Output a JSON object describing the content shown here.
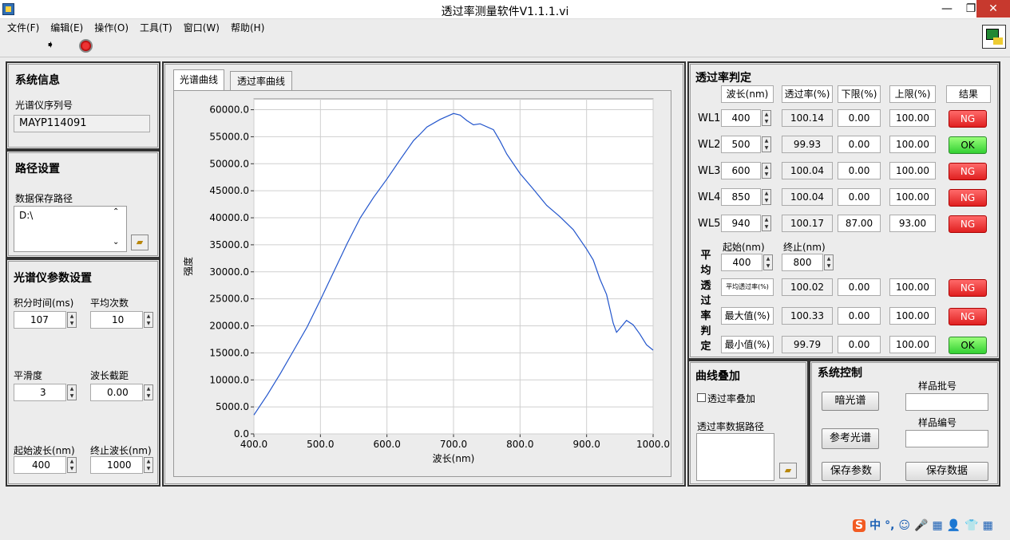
{
  "window": {
    "title": "透过率测量软件V1.1.1.vi",
    "min_glyph": "—",
    "max_glyph": "❐",
    "close_glyph": "✕"
  },
  "menu": [
    "文件(F)",
    "编辑(E)",
    "操作(O)",
    "工具(T)",
    "窗口(W)",
    "帮助(H)"
  ],
  "system_info": {
    "title": "系统信息",
    "serial_label": "光谱仪序列号",
    "serial_value": "MAYP114091"
  },
  "path_settings": {
    "title": "路径设置",
    "path_label": "数据保存路径",
    "path_value": "D:\\"
  },
  "spectrometer": {
    "title": "光谱仪参数设置",
    "integration_label": "积分时间(ms)",
    "integration_value": "107",
    "avg_label": "平均次数",
    "avg_value": "10",
    "smooth_label": "平滑度",
    "smooth_value": "3",
    "cutoff_label": "波长截距",
    "cutoff_value": "0.00",
    "start_label": "起始波长(nm)",
    "start_value": "400",
    "end_label": "终止波长(nm)",
    "end_value": "1000"
  },
  "tabs": [
    "光谱曲线",
    "透过率曲线"
  ],
  "chart_data": {
    "type": "line",
    "xlabel": "波长(nm)",
    "ylabel": "强度",
    "xlim": [
      400,
      1000
    ],
    "ylim": [
      0,
      62000
    ],
    "x_ticks": [
      "400.0",
      "500.0",
      "600.0",
      "700.0",
      "800.0",
      "900.0",
      "1000.0"
    ],
    "y_ticks": [
      "0.0",
      "5000.0",
      "10000.0",
      "15000.0",
      "20000.0",
      "25000.0",
      "30000.0",
      "35000.0",
      "40000.0",
      "45000.0",
      "50000.0",
      "55000.0",
      "60000.0"
    ],
    "grid": true,
    "series": [
      {
        "color": "#2255cc",
        "x": [
          400,
          420,
          440,
          460,
          480,
          500,
          520,
          540,
          560,
          580,
          600,
          620,
          640,
          650,
          660,
          680,
          700,
          710,
          720,
          730,
          740,
          760,
          770,
          780,
          800,
          820,
          840,
          860,
          880,
          900,
          910,
          920,
          930,
          940,
          945,
          950,
          960,
          970,
          980,
          990,
          1000
        ],
        "y": [
          3500,
          7200,
          11200,
          15500,
          19800,
          24800,
          30000,
          35200,
          40000,
          43800,
          47200,
          50800,
          54300,
          55500,
          56800,
          58200,
          59300,
          59000,
          58000,
          57200,
          57400,
          56300,
          54200,
          51800,
          48200,
          45300,
          42300,
          40200,
          37800,
          34200,
          32200,
          28700,
          25800,
          20500,
          18800,
          19500,
          21000,
          20200,
          18500,
          16500,
          15500
        ]
      }
    ]
  },
  "judgement": {
    "title": "透过率判定",
    "headers": [
      "波长(nm)",
      "透过率(%)",
      "下限(%)",
      "上限(%)",
      "结果"
    ],
    "rows": [
      {
        "label": "WL1",
        "wl": "400",
        "trans": "100.14",
        "low": "0.00",
        "high": "100.00",
        "result": "NG"
      },
      {
        "label": "WL2",
        "wl": "500",
        "trans": "99.93",
        "low": "0.00",
        "high": "100.00",
        "result": "OK"
      },
      {
        "label": "WL3",
        "wl": "600",
        "trans": "100.04",
        "low": "0.00",
        "high": "100.00",
        "result": "NG"
      },
      {
        "label": "WL4",
        "wl": "850",
        "trans": "100.04",
        "low": "0.00",
        "high": "100.00",
        "result": "NG"
      },
      {
        "label": "WL5",
        "wl": "940",
        "trans": "100.17",
        "low": "87.00",
        "high": "93.00",
        "result": "NG"
      }
    ],
    "avg_vertical": [
      "平",
      "均",
      "透",
      "过",
      "率",
      "判",
      "定"
    ],
    "start_label": "起始(nm)",
    "start_value": "400",
    "end_label": "终止(nm)",
    "end_value": "800",
    "stats": [
      {
        "label": "平均透过率(%)",
        "value": "100.02",
        "low": "0.00",
        "high": "100.00",
        "result": "NG"
      },
      {
        "label": "最大值(%)",
        "value": "100.33",
        "low": "0.00",
        "high": "100.00",
        "result": "NG"
      },
      {
        "label": "最小值(%)",
        "value": "99.79",
        "low": "0.00",
        "high": "100.00",
        "result": "OK"
      }
    ]
  },
  "overlay": {
    "title": "曲线叠加",
    "checkbox_label": "透过率叠加",
    "path_label": "透过率数据路径"
  },
  "control": {
    "title": "系统控制",
    "dark_btn": "暗光谱",
    "ref_btn": "参考光谱",
    "batch_label": "样品批号",
    "sample_label": "样品编号",
    "save_params": "保存参数",
    "save_data": "保存数据"
  },
  "ime": {
    "items": [
      "S",
      "中",
      "°,",
      "☺",
      "🎤",
      "▦",
      "👤",
      "👕",
      "▦"
    ]
  }
}
